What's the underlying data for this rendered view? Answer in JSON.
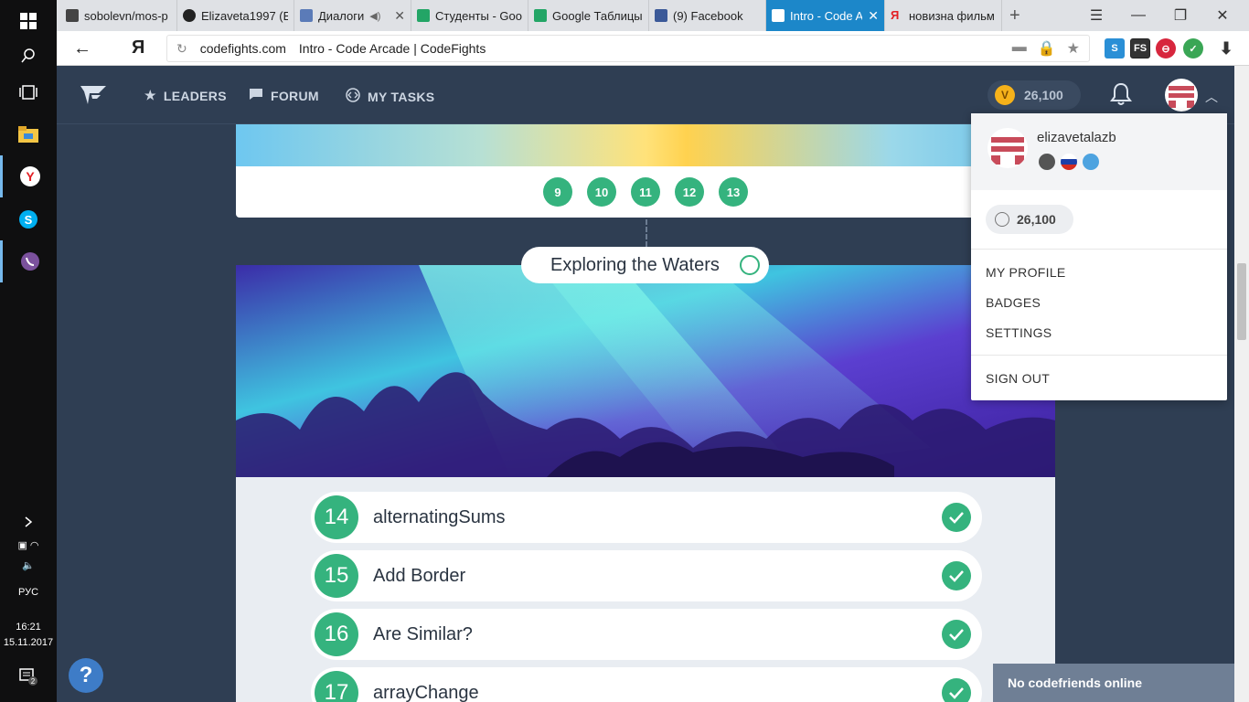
{
  "taskbar": {
    "lang": "РУС",
    "time": "16:21",
    "date": "15.11.2017",
    "notifications": "2"
  },
  "tabs": [
    {
      "label": "sobolevn/mos-p",
      "icon": "repo-icon"
    },
    {
      "label": "Elizaveta1997 (E",
      "icon": "github-icon"
    },
    {
      "label": "Диалоги",
      "icon": "media-icon"
    },
    {
      "label": "Студенты - Goo",
      "icon": "sheets-icon"
    },
    {
      "label": "Google Таблицы",
      "icon": "sheets-icon"
    },
    {
      "label": "(9) Facebook",
      "icon": "facebook-icon"
    },
    {
      "label": "Intro - Code A",
      "icon": "codefights-icon"
    },
    {
      "label": "новизна фильм",
      "icon": "yandex-icon"
    }
  ],
  "address": {
    "back": "←",
    "yandex": "Я",
    "domain": "codefights.com",
    "title": "Intro - Code Arcade | CodeFights"
  },
  "nav": {
    "leaders": "LEADERS",
    "forum": "FORUM",
    "my_tasks": "MY TASKS",
    "coins": "26,100"
  },
  "prev_levels": [
    "9",
    "10",
    "11",
    "12",
    "13"
  ],
  "topic": "Exploring the Waters",
  "tasks": [
    {
      "num": "14",
      "name": "alternatingSums"
    },
    {
      "num": "15",
      "name": "Add Border"
    },
    {
      "num": "16",
      "name": "Are Similar?"
    },
    {
      "num": "17",
      "name": "arrayChange"
    }
  ],
  "dropdown": {
    "username": "elizavetalazb",
    "coins": "26,100",
    "items": [
      "MY PROFILE",
      "BADGES",
      "SETTINGS"
    ],
    "sign_out": "SIGN OUT"
  },
  "help": "?",
  "codefriends": "No codefriends online",
  "colors": {
    "accent_green": "#35b37e",
    "nav_bg": "#2f3e53",
    "active_tab": "#1c87c9"
  }
}
